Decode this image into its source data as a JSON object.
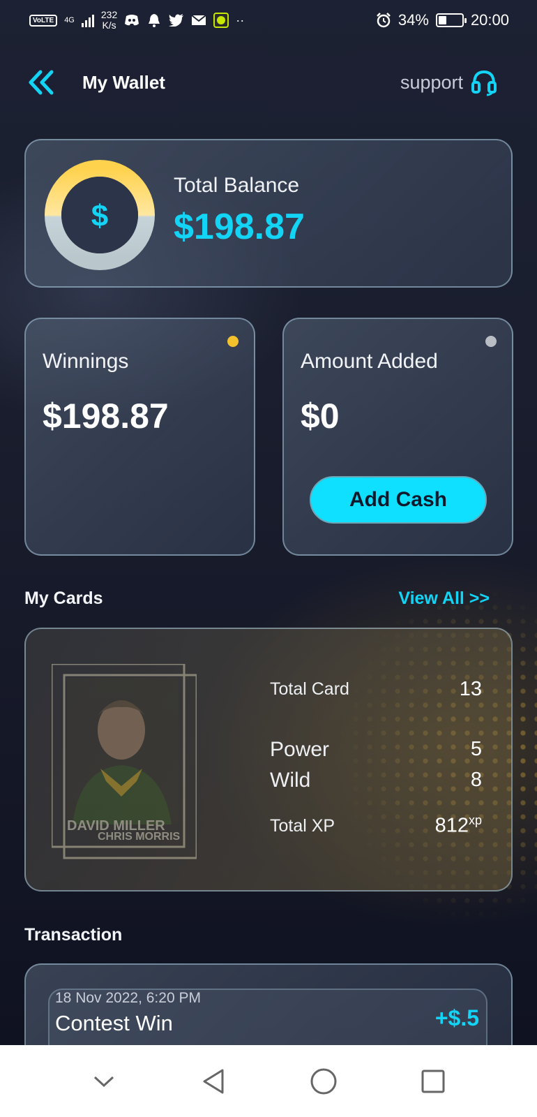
{
  "status_bar": {
    "volte": "VoLTE",
    "network": "4G",
    "speed_value": "232",
    "speed_unit": "K/s",
    "battery_percent": "34%",
    "battery_level": 0.34,
    "time": "20:00"
  },
  "header": {
    "title": "My Wallet",
    "support_label": "support"
  },
  "balance": {
    "label": "Total Balance",
    "value": "$198.87",
    "currency_symbol": "$"
  },
  "winnings": {
    "label": "Winnings",
    "value": "$198.87",
    "dot_color": "#f2c12e"
  },
  "amount_added": {
    "label": "Amount Added",
    "value": "$0",
    "dot_color": "#b9bec4",
    "button_label": "Add Cash"
  },
  "my_cards": {
    "title": "My Cards",
    "view_all_label": "View All >>",
    "stats": [
      {
        "label": "Total Card",
        "value": "13"
      },
      {
        "label": "Power",
        "value": "5"
      },
      {
        "label": "Wild",
        "value": "8"
      },
      {
        "label": "Total XP",
        "value": "812",
        "unit": "xp"
      }
    ],
    "player_names": [
      "DAVID MILLER",
      "CHRIS MORRIS"
    ]
  },
  "transaction": {
    "title": "Transaction",
    "items": [
      {
        "date": "18 Nov 2022, 6:20 PM",
        "title": "Contest Win",
        "amount": "+$.5"
      }
    ]
  },
  "colors": {
    "accent": "#13d4f5",
    "button": "#0fe0ff",
    "ring_top": "#ffd24d",
    "ring_bottom": "#c6d3d8"
  },
  "icons": [
    "back-chevrons-icon",
    "headset-icon",
    "dollar-icon",
    "alarm-icon",
    "bell-icon",
    "twitter-icon",
    "mail-icon",
    "discord-icon"
  ]
}
